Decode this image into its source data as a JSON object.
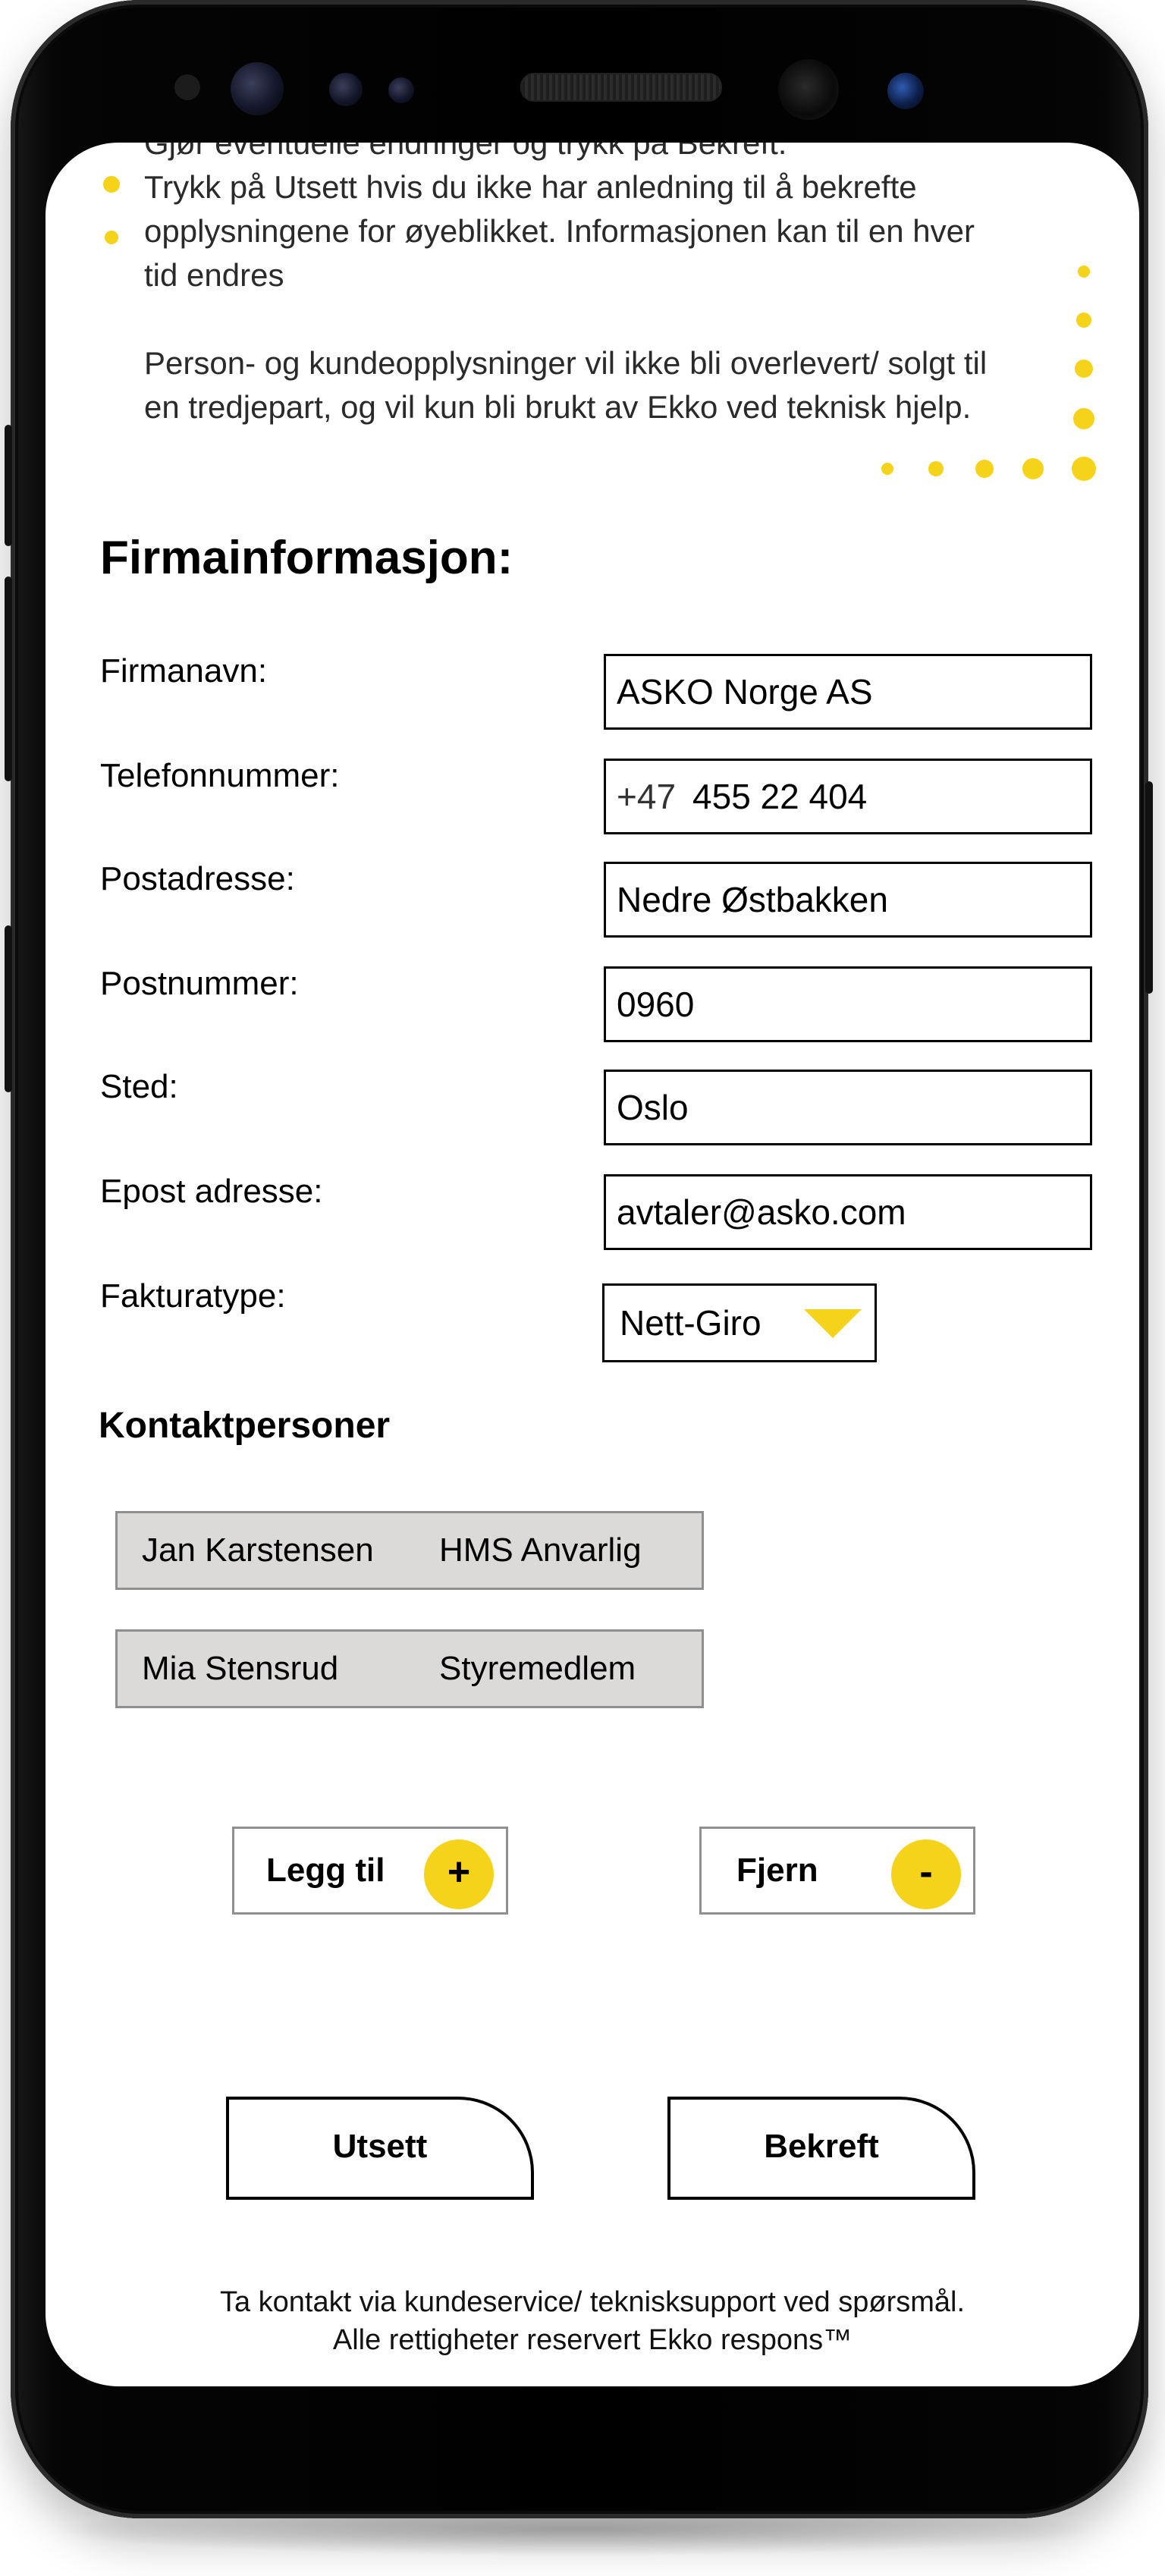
{
  "intro": {
    "cut_line": "Gjør eventuelle endringer og trykk på Bekreft.",
    "line1": "Trykk på Utsett hvis du ikke har anledning til å bekrefte",
    "line2": "opplysningene for øyeblikket. Informasjonen kan til en hver",
    "line3": "tid endres",
    "line4": "Person- og kundeopplysninger vil ikke bli overlevert/ solgt til",
    "line5": "en tredjepart, og vil kun bli brukt av Ekko ved teknisk hjelp."
  },
  "section_title": "Firmainformasjon:",
  "fields": [
    {
      "label": "Firmanavn:",
      "value": "ASKO Norge AS"
    },
    {
      "label": "Telefonnummer:",
      "prefix": "+47",
      "value": "455 22 404"
    },
    {
      "label": "Postadresse:",
      "value": "Nedre Østbakken"
    },
    {
      "label": "Postnummer:",
      "value": "0960"
    },
    {
      "label": "Sted:",
      "value": "Oslo"
    },
    {
      "label": "Epost adresse:",
      "value": "avtaler@asko.com"
    }
  ],
  "invoice": {
    "label": "Fakturatype:",
    "selected": "Nett-Giro"
  },
  "contacts": {
    "title": "Kontaktpersoner",
    "rows": [
      {
        "name": "Jan Karstensen",
        "role": "HMS Anvarlig"
      },
      {
        "name": "Mia Stensrud",
        "role": "Styremedlem"
      }
    ]
  },
  "actions": {
    "add_label": "Legg til",
    "add_symbol": "+",
    "remove_label": "Fjern",
    "remove_symbol": "-",
    "postpone_label": "Utsett",
    "confirm_label": "Bekreft"
  },
  "footer": {
    "line1": "Ta kontakt via kundeservice/ teknisksupport ved spørsmål.",
    "line2": "Alle rettigheter reservert Ekko respons™"
  },
  "colors": {
    "accent": "#f5d31a",
    "row_bg": "#dcd9d9"
  }
}
